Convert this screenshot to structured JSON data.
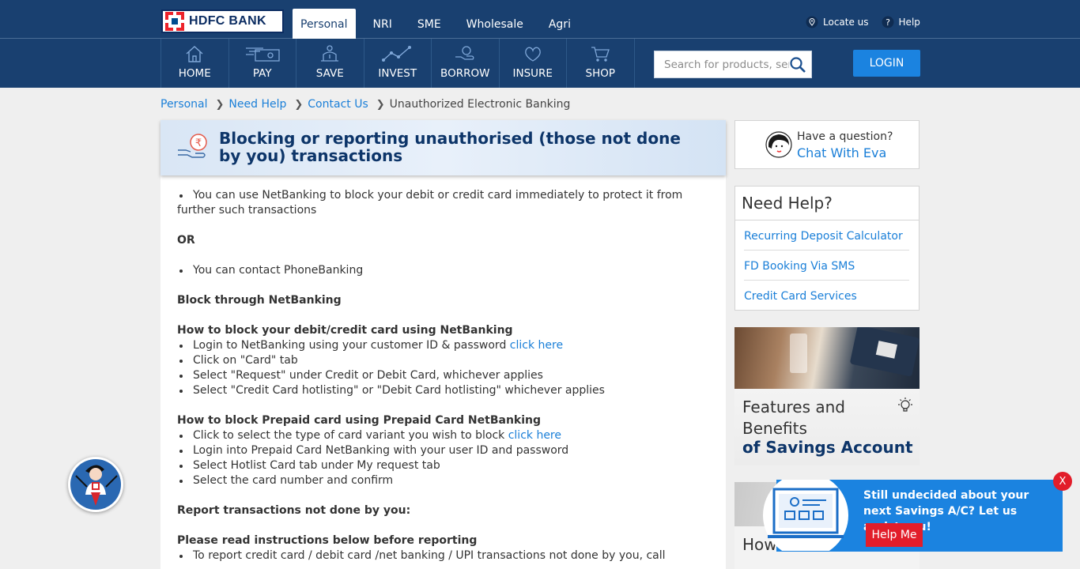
{
  "header": {
    "logo_text": "HDFC BANK",
    "tabs": [
      "Personal",
      "NRI",
      "SME",
      "Wholesale",
      "Agri"
    ],
    "active_tab": "Personal",
    "locate_label": "Locate us",
    "help_label": "Help"
  },
  "nav": {
    "items": [
      {
        "label": "HOME",
        "icon": "home-icon"
      },
      {
        "label": "PAY",
        "icon": "pay-icon"
      },
      {
        "label": "SAVE",
        "icon": "save-icon"
      },
      {
        "label": "INVEST",
        "icon": "invest-icon"
      },
      {
        "label": "BORROW",
        "icon": "borrow-icon"
      },
      {
        "label": "INSURE",
        "icon": "insure-icon"
      },
      {
        "label": "SHOP",
        "icon": "shop-icon"
      }
    ],
    "search_placeholder": "Search for products, servi...",
    "login_label": "LOGIN"
  },
  "breadcrumb": [
    "Personal",
    "Need Help",
    "Contact Us",
    "Unauthorized Electronic Banking"
  ],
  "main": {
    "title": "Blocking or reporting unauthorised (those not done by you) transactions",
    "bullet_netbanking": "You can use NetBanking to block your debit or credit card immediately to protect it from further such transactions",
    "or": "OR",
    "bullet_phone": "You can contact PhoneBanking",
    "block_heading": "Block through NetBanking",
    "debit_heading": "How to block your debit/credit card using NetBanking",
    "debit_steps": [
      {
        "text": "Login to NetBanking using your customer ID & password ",
        "link": "click here"
      },
      {
        "text": "Click on \"Card\" tab",
        "link": ""
      },
      {
        "text": "Select \"Request\" under Credit or Debit Card, whichever applies",
        "link": ""
      },
      {
        "text": "Select \"Credit Card hotlisting\" or \"Debit Card hotlisting\" whichever applies",
        "link": ""
      }
    ],
    "prepaid_heading": "How to block Prepaid card using Prepaid Card NetBanking",
    "prepaid_steps": [
      {
        "text": "Click to select the type of card variant you wish to block ",
        "link": "click here"
      },
      {
        "text": "Login into Prepaid Card NetBanking with your user ID and password",
        "link": ""
      },
      {
        "text": "Select Hotlist Card tab under My request tab",
        "link": ""
      },
      {
        "text": "Select the card number and confirm",
        "link": ""
      }
    ],
    "report_heading": "Report transactions not done by you:",
    "instructions_heading": "Please read instructions below before reporting",
    "report_step": "To report credit card / debit card /net banking / UPI transactions not done by you, call"
  },
  "sidebar": {
    "eva_question": "Have a question?",
    "eva_link": "Chat With Eva",
    "need_help_title": "Need Help?",
    "need_help_links": [
      "Recurring Deposit Calculator",
      "FD Booking Via SMS",
      "Credit Card Services"
    ],
    "promo_line1": "Features and Benefits",
    "promo_line2": "of Savings Account",
    "promo2_text": "How is the"
  },
  "popup": {
    "text": "Still undecided about your next Savings A/C? Let us assist you!",
    "button": "Help Me",
    "close": "X"
  },
  "colors": {
    "header_bg": "#194070",
    "accent_blue": "#1b83e0",
    "link": "#1a7fd8",
    "title_navy": "#0d3569",
    "alert_red": "#e21d2a"
  }
}
